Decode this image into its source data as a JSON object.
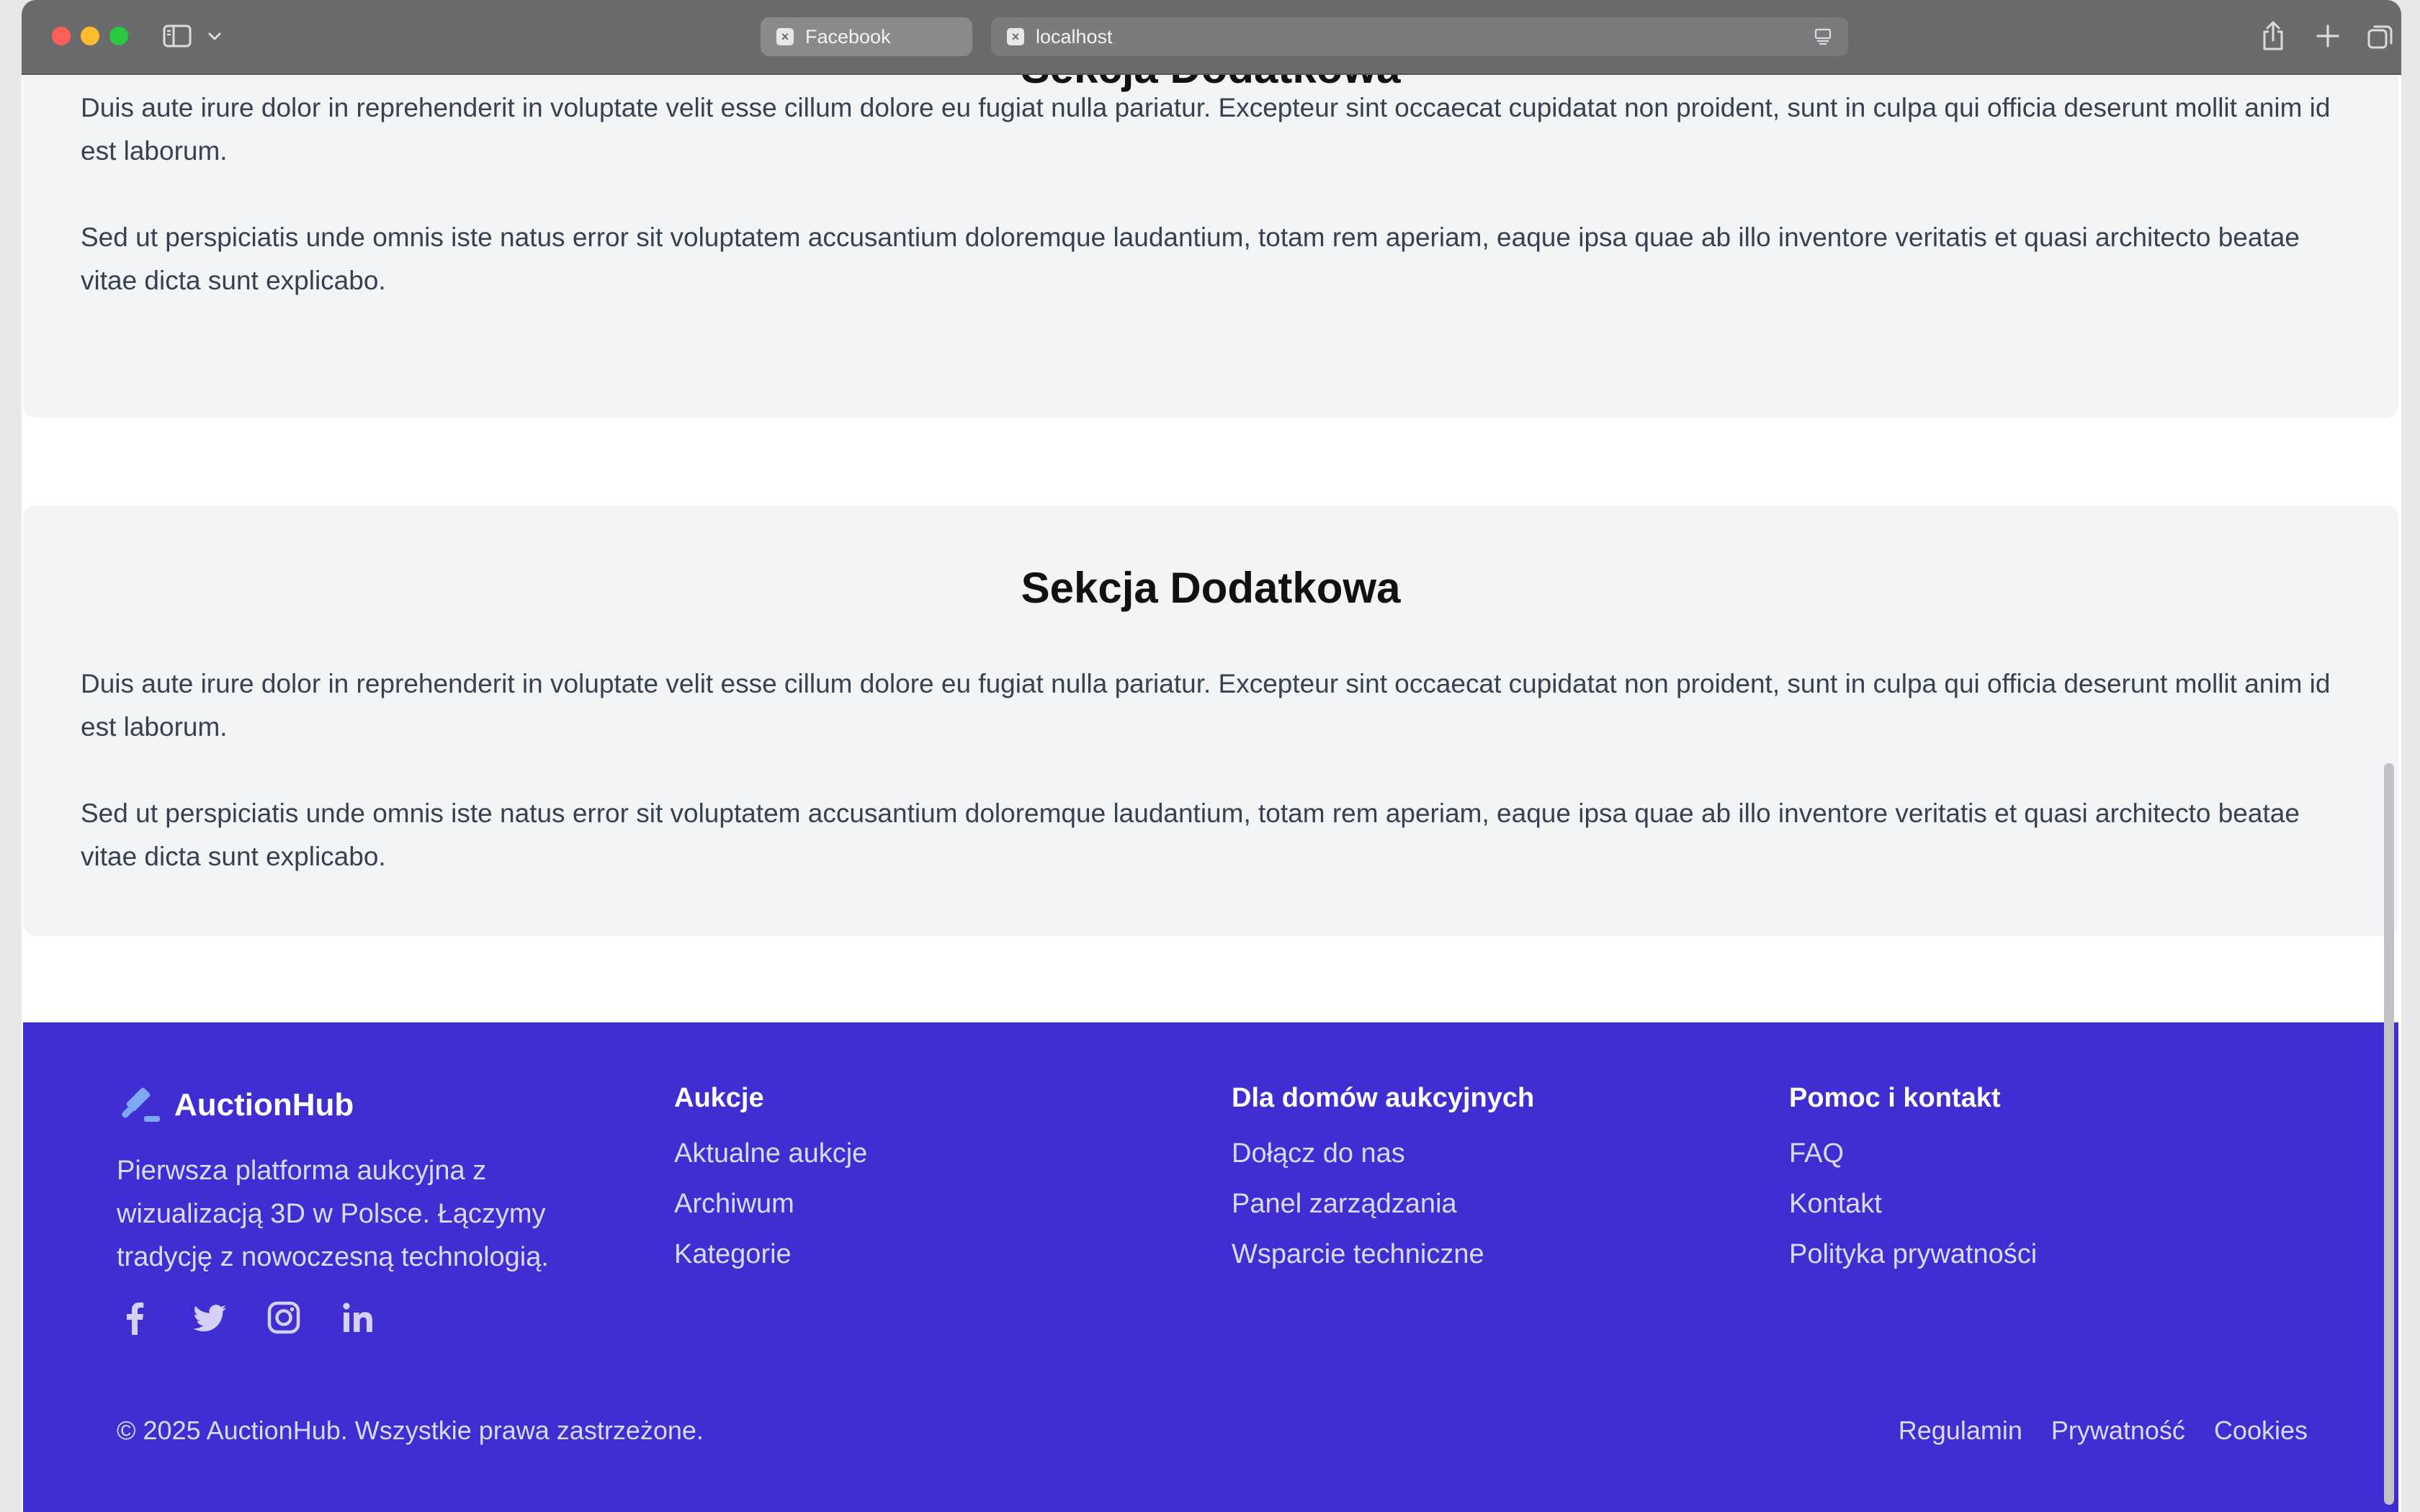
{
  "browser": {
    "tabs": [
      {
        "label": "Facebook",
        "favicon": "x-favicon-icon"
      },
      {
        "label": "localhost",
        "favicon": "x-favicon-icon"
      }
    ],
    "icons": [
      "sidebar-icon",
      "chevron-down-icon",
      "reader-icon",
      "share-icon",
      "plus-icon",
      "tabs-overview-icon"
    ]
  },
  "sections": [
    {
      "title": "Sekcja Dodatkowa",
      "paragraphs": [
        "Duis aute irure dolor in reprehenderit in voluptate velit esse cillum dolore eu fugiat nulla pariatur. Excepteur sint occaecat cupidatat non proident, sunt in culpa qui officia deserunt mollit anim id est laborum.",
        "Sed ut perspiciatis unde omnis iste natus error sit voluptatem accusantium doloremque laudantium, totam rem aperiam, eaque ipsa quae ab illo inventore veritatis et quasi architecto beatae vitae dicta sunt explicabo."
      ]
    },
    {
      "title": "Sekcja Dodatkowa",
      "paragraphs": [
        "Duis aute irure dolor in reprehenderit in voluptate velit esse cillum dolore eu fugiat nulla pariatur. Excepteur sint occaecat cupidatat non proident, sunt in culpa qui officia deserunt mollit anim id est laborum.",
        "Sed ut perspiciatis unde omnis iste natus error sit voluptatem accusantium doloremque laudantium, totam rem aperiam, eaque ipsa quae ab illo inventore veritatis et quasi architecto beatae vitae dicta sunt explicabo."
      ]
    }
  ],
  "footer": {
    "brand": "AuctionHub",
    "tagline": "Pierwsza platforma aukcyjna z wizualizacją 3D w Polsce. Łączymy tradycję z nowoczesną technologią.",
    "socials": [
      "facebook-icon",
      "twitter-icon",
      "instagram-icon",
      "linkedin-icon"
    ],
    "columns": [
      {
        "heading": "Aukcje",
        "links": [
          "Aktualne aukcje",
          "Archiwum",
          "Kategorie"
        ]
      },
      {
        "heading": "Dla domów aukcyjnych",
        "links": [
          "Dołącz do nas",
          "Panel zarządzania",
          "Wsparcie techniczne"
        ]
      },
      {
        "heading": "Pomoc i kontakt",
        "links": [
          "FAQ",
          "Kontakt",
          "Polityka prywatności"
        ]
      }
    ],
    "copyright": "© 2025 AuctionHub. Wszystkie prawa zastrzeżone.",
    "legal_links": [
      "Regulamin",
      "Prywatność",
      "Cookies"
    ]
  },
  "colors": {
    "footer_bg": "#3f2fd2",
    "section_bg": "#f3f4f6",
    "brand_icon": "#7fa8f7"
  }
}
